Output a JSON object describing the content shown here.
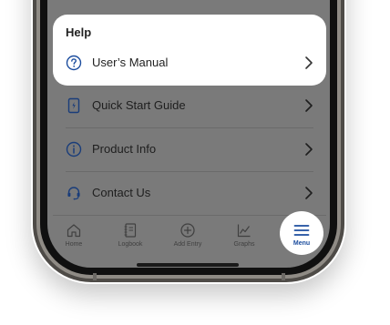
{
  "help": {
    "title": "Help",
    "items": [
      {
        "label": "User’s Manual",
        "icon": "question-circle-icon"
      }
    ]
  },
  "menu_items": [
    {
      "label": "Quick Start Guide",
      "icon": "guide-book-icon"
    },
    {
      "label": "Product Info",
      "icon": "info-circle-icon"
    },
    {
      "label": "Contact Us",
      "icon": "headset-icon"
    }
  ],
  "tab_bar": {
    "tabs": [
      {
        "label": "Home",
        "icon": "home-icon"
      },
      {
        "label": "Logbook",
        "icon": "logbook-icon"
      },
      {
        "label": "Add Entry",
        "icon": "add-circle-icon"
      },
      {
        "label": "Graphs",
        "icon": "chart-icon"
      },
      {
        "label": "Menu",
        "icon": "hamburger-icon",
        "active": true
      }
    ]
  },
  "colors": {
    "accent": "#1c4d9e",
    "overlay": "#7a7a7a",
    "card": "#ffffff",
    "text": "#222222"
  }
}
